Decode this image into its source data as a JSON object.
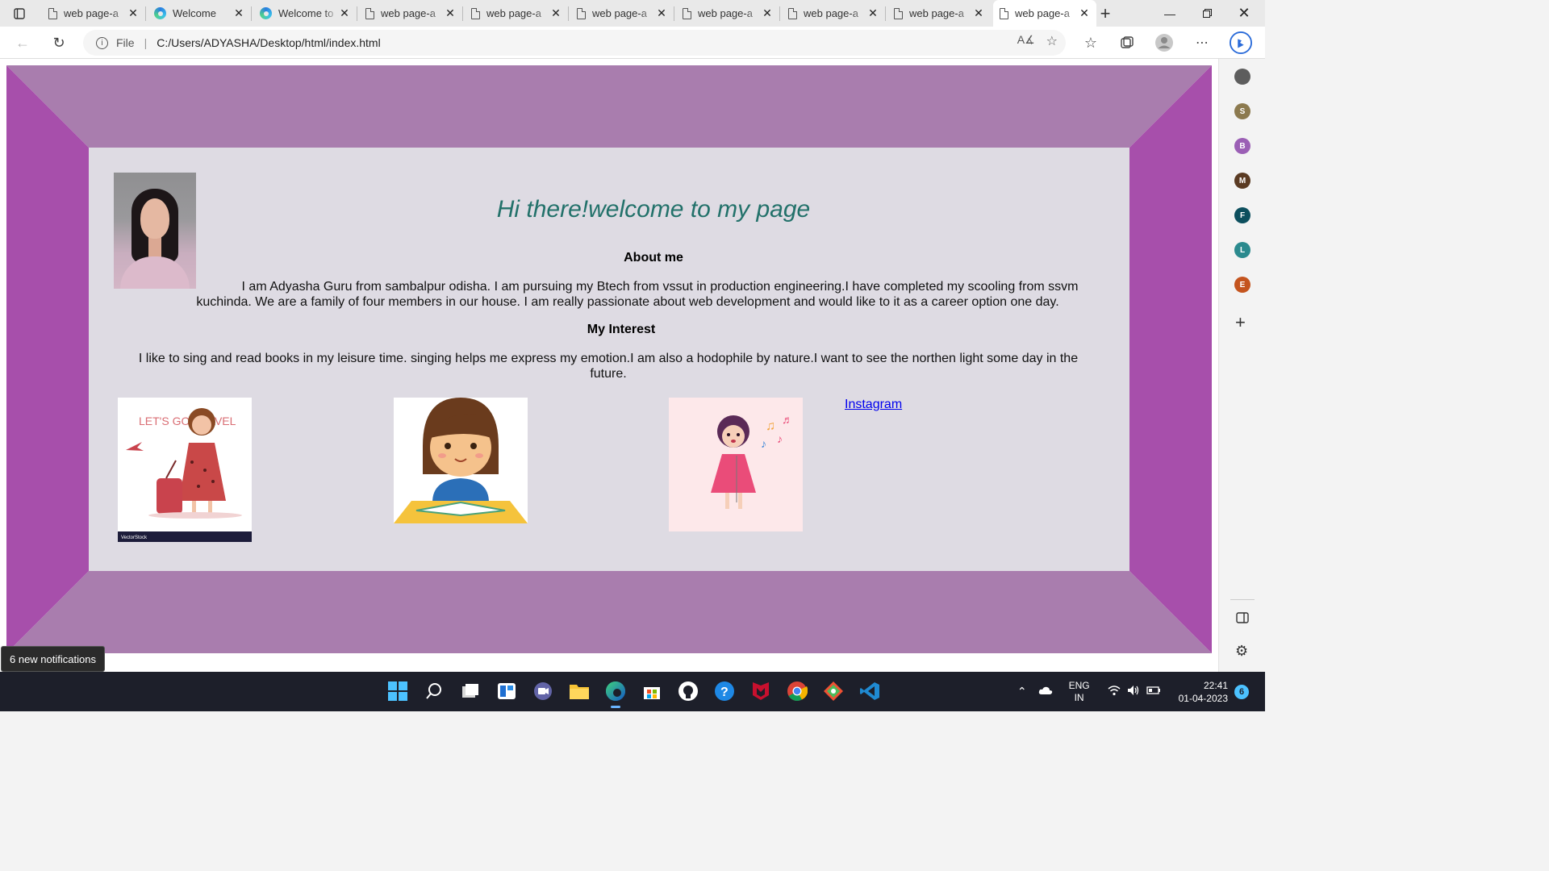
{
  "browser": {
    "tabs": [
      {
        "label": "web page-a",
        "icon": "doc"
      },
      {
        "label": "Welcome",
        "icon": "edge"
      },
      {
        "label": "Welcome to",
        "icon": "edge"
      },
      {
        "label": "web page-a",
        "icon": "doc"
      },
      {
        "label": "web page-a",
        "icon": "doc"
      },
      {
        "label": "web page-a",
        "icon": "doc"
      },
      {
        "label": "web page-a",
        "icon": "doc"
      },
      {
        "label": "web page-a",
        "icon": "doc"
      },
      {
        "label": "web page-a",
        "icon": "doc"
      },
      {
        "label": "web page-a",
        "icon": "doc",
        "active": true
      }
    ],
    "address": {
      "scheme_label": "File",
      "path": "C:/Users/ADYASHA/Desktop/html/index.html"
    },
    "sidebar": {
      "profiles": [
        {
          "letter": "",
          "color": "#5d5d5d"
        },
        {
          "letter": "S",
          "color": "#8c7a4f"
        },
        {
          "letter": "B",
          "color": "#9b5fb5"
        },
        {
          "letter": "M",
          "color": "#5a3b23"
        },
        {
          "letter": "F",
          "color": "#0d4f5e"
        },
        {
          "letter": "L",
          "color": "#2b8a8e"
        },
        {
          "letter": "E",
          "color": "#c4541e"
        }
      ]
    }
  },
  "page": {
    "colors": {
      "frame_top": "#a97dae",
      "frame_side": "#a74fab",
      "inner_bg": "#dedbe3",
      "heading": "#22716a"
    },
    "heading": "Hi there!welcome to my page",
    "about_title": "About me",
    "about_text": "I am Adyasha Guru from sambalpur odisha. I am pursuing my Btech from vssut in production engineering.I have completed my scooling from ssvm kuchinda. We are a family of four members in our house. I am really passionate about web development and would like to it as a career option one day.",
    "interest_title": "My Interest",
    "interest_text": "I like to sing and read books in my leisure time. singing helps me express my emotion.I am also a hodophile by nature.I want to see the northen light some day in the future.",
    "travel_image_text": "LET'S GO TRAVEL",
    "travel_image_credit": "VectorStock",
    "instagram_link": "Instagram"
  },
  "notification": "6 new notifications",
  "taskbar": {
    "lang_top": "ENG",
    "lang_bottom": "IN",
    "time": "22:41",
    "date": "01-04-2023",
    "badge": "6"
  }
}
